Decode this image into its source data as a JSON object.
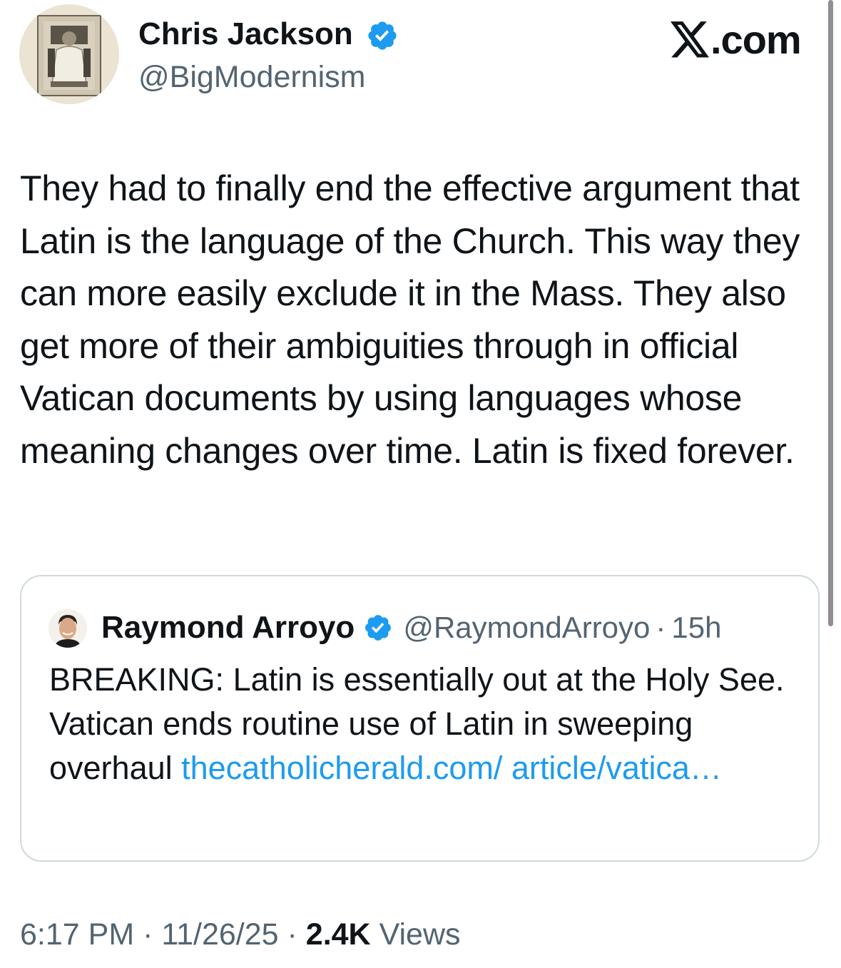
{
  "author": {
    "name": "Chris Jackson",
    "handle": "@BigModernism",
    "avatar_icon": "pope-portrait-avatar",
    "verified_color": "#1d9bf0"
  },
  "brand": {
    "text": ".com",
    "icon": "x-logo-icon"
  },
  "tweet": {
    "text": "They had to finally end the effective argument that Latin is the language of the Church. This way they can more easily exclude it in the Mass. They also get more of their ambiguities through in official Vatican documents by using languages whose meaning changes over time. Latin is fixed forever."
  },
  "quote": {
    "name": "Raymond Arroyo",
    "handle": "@RaymondArroyo",
    "separator": "·",
    "time": "15h",
    "text": "BREAKING: Latin is essentially out at the Holy See. Vatican ends routine use of Latin in sweeping overhaul ",
    "link": "thecatholicherald.com/ article/vatica…",
    "link_color": "#1d9bf0"
  },
  "meta": {
    "time": "6:17 PM",
    "sep1": " · ",
    "date": "11/26/25",
    "sep2": " · ",
    "views_count": "2.4K",
    "views_label": " Views"
  }
}
